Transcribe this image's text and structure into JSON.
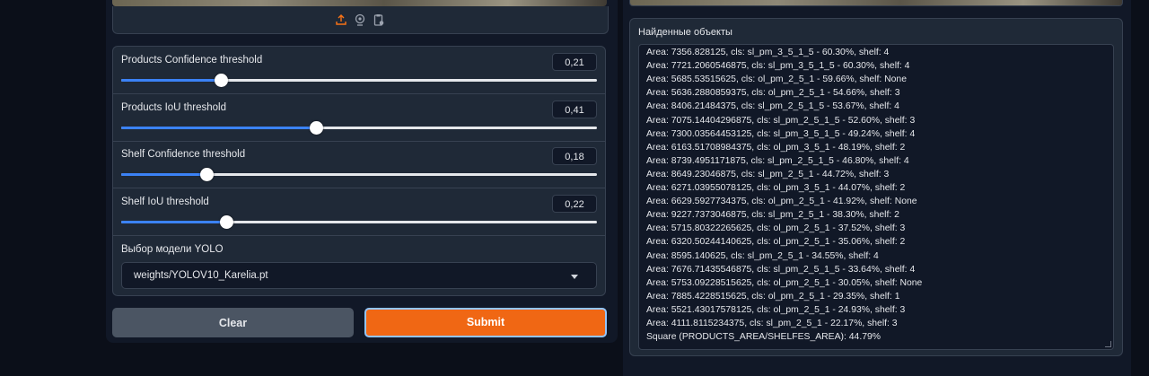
{
  "image_toolbar": {
    "icons": [
      "upload-icon",
      "webcam-icon",
      "clipboard-icon"
    ]
  },
  "sliders": [
    {
      "label": "Products Confidence threshold",
      "value": "0,21",
      "fraction": 0.21
    },
    {
      "label": "Products IoU threshold",
      "value": "0,41",
      "fraction": 0.41
    },
    {
      "label": "Shelf Confidence threshold",
      "value": "0,18",
      "fraction": 0.18
    },
    {
      "label": "Shelf IoU threshold",
      "value": "0,22",
      "fraction": 0.22
    }
  ],
  "model": {
    "label": "Выбор модели YOLO",
    "value": "weights/YOLOV10_Karelia.pt"
  },
  "buttons": {
    "clear": "Clear",
    "submit": "Submit"
  },
  "results": {
    "label": "Найденные объекты",
    "lines": [
      "Area: 7356.828125, cls: sl_pm_3_5_1_5 - 60.30%, shelf: 4",
      "Area: 7721.2060546875, cls: sl_pm_3_5_1_5 - 60.30%, shelf: 4",
      "Area: 5685.53515625, cls: ol_pm_2_5_1 - 59.66%, shelf: None",
      "Area: 5636.2880859375, cls: ol_pm_2_5_1 - 54.66%, shelf: 3",
      "Area: 8406.21484375, cls: sl_pm_2_5_1_5 - 53.67%, shelf: 4",
      "Area: 7075.14404296875, cls: sl_pm_2_5_1_5 - 52.60%, shelf: 3",
      "Area: 7300.03564453125, cls: sl_pm_3_5_1_5 - 49.24%, shelf: 4",
      "Area: 6163.51708984375, cls: ol_pm_3_5_1 - 48.19%, shelf: 2",
      "Area: 8739.4951171875, cls: sl_pm_2_5_1_5 - 46.80%, shelf: 4",
      "Area: 8649.23046875, cls: sl_pm_2_5_1 - 44.72%, shelf: 3",
      "Area: 6271.03955078125, cls: ol_pm_3_5_1 - 44.07%, shelf: 2",
      "Area: 6629.5927734375, cls: ol_pm_2_5_1 - 41.92%, shelf: None",
      "Area: 9227.7373046875, cls: sl_pm_2_5_1 - 38.30%, shelf: 2",
      "Area: 5715.80322265625, cls: ol_pm_2_5_1 - 37.52%, shelf: 3",
      "Area: 6320.50244140625, cls: ol_pm_2_5_1 - 35.06%, shelf: 2",
      "Area: 8595.140625, cls: sl_pm_2_5_1 - 34.55%, shelf: 4",
      "Area: 7676.71435546875, cls: sl_pm_2_5_1_5 - 33.64%, shelf: 4",
      "Area: 5753.09228515625, cls: ol_pm_2_5_1 - 30.05%, shelf: None",
      "Area: 7885.4228515625, cls: ol_pm_2_5_1 - 29.35%, shelf: 1",
      "Area: 5521.43017578125, cls: ol_pm_2_5_1 - 24.93%, shelf: 3",
      "Area: 4111.8115234375, cls: sl_pm_2_5_1 - 22.17%, shelf: 3",
      "Square (PRODUCTS_AREA/SHELFES_AREA): 44.79%"
    ]
  },
  "colors": {
    "accent": "#f06714",
    "slider_fill": "#3b82f6",
    "background": "#0b0f19",
    "panel": "#1f2937"
  }
}
